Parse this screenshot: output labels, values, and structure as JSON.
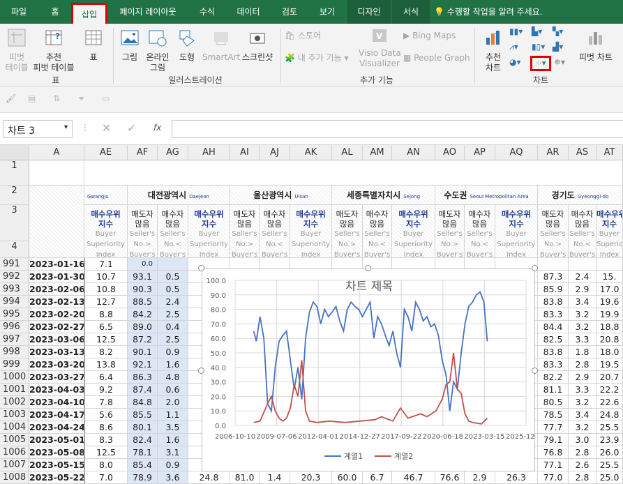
{
  "tabs": [
    "파일",
    "홈",
    "삽입",
    "페이지 레이아웃",
    "수식",
    "데이터",
    "검토",
    "보기",
    "디자인",
    "서식"
  ],
  "tell_me": "수행할 작업을 알려 주세요.",
  "ribbon": {
    "pivot": "피벗\n테이블",
    "rec_pivot": "추천\n피벗 테이블",
    "table": "표",
    "group_table": "표",
    "picture": "그림",
    "online_pic": "온라인\n그림",
    "shapes": "도형",
    "smartart": "SmartArt",
    "screenshot": "스크린샷",
    "group_illus": "일러스트레이션",
    "store": "스토어",
    "my_addins": "내 추가 기능",
    "visio": "Visio Data\nVisualizer",
    "bing": "Bing Maps",
    "people": "People Graph",
    "group_addins": "추가 기능",
    "rec_chart": "추천\n차트",
    "pivot_chart": "피벗 차트",
    "group_chart": "차트"
  },
  "namebox": "차트 3",
  "fx": "fx",
  "columns": [
    "A",
    "AE",
    "AF",
    "AG",
    "AH",
    "AI",
    "AJ",
    "AK",
    "AL",
    "AM",
    "AN",
    "AO",
    "AP",
    "AQ",
    "AR",
    "AS",
    "AT"
  ],
  "header_row2": {
    "gwangju": "Gwangju",
    "daejeon": "대전광역시",
    "daejeon_en": "Daejeon",
    "ulsan": "울산광역시",
    "ulsan_en": "Ulsan",
    "sejong": "세종특별자치시",
    "sejong_en": "Sejong",
    "capital": "수도권",
    "capital_en": "Seoul Metropolitan Area",
    "gyeonggi": "경기도",
    "gyeonggi_en": "Gyeonggi-do"
  },
  "header_row3": {
    "bsi": "매수우위\n지수",
    "sell_more": "매도자\n많음",
    "buy_more": "매수자\n많음",
    "bsi_en": "Buyer\nSuperiority\nIndex",
    "sell_en": "Seller's\nNo.>\nBuyer's",
    "buy_en": "Seller's\nNo.<\nBuyer's"
  },
  "rows": [
    {
      "n": "991",
      "date": "2023-01-16",
      "ae": "7.1",
      "af": "0.0",
      "ag": "",
      "ah": "",
      "ar": "",
      "as": "",
      "at": ""
    },
    {
      "n": "992",
      "date": "2023-01-30",
      "ae": "10.7",
      "af": "93.1",
      "ag": "0.5",
      "ah": "",
      "ar": "87.3",
      "as": "2.4",
      "at": "15."
    },
    {
      "n": "993",
      "date": "2023-02-06",
      "ae": "10.8",
      "af": "90.3",
      "ag": "0.5",
      "ah": "",
      "ar": "85.9",
      "as": "2.9",
      "at": "17.0"
    },
    {
      "n": "994",
      "date": "2023-02-13",
      "ae": "12.7",
      "af": "88.5",
      "ag": "2.4",
      "ah": "",
      "ar": "83.8",
      "as": "3.4",
      "at": "19.6"
    },
    {
      "n": "995",
      "date": "2023-02-20",
      "ae": "8.8",
      "af": "84.2",
      "ag": "2.5",
      "ah": "",
      "ar": "83.3",
      "as": "3.2",
      "at": "19.9"
    },
    {
      "n": "996",
      "date": "2023-02-27",
      "ae": "6.5",
      "af": "89.0",
      "ag": "0.4",
      "ah": "",
      "ar": "84.4",
      "as": "3.2",
      "at": "18.8"
    },
    {
      "n": "997",
      "date": "2023-03-06",
      "ae": "12.5",
      "af": "87.2",
      "ag": "2.5",
      "ah": "",
      "ar": "82.5",
      "as": "3.3",
      "at": "20.8"
    },
    {
      "n": "998",
      "date": "2023-03-13",
      "ae": "8.2",
      "af": "90.1",
      "ag": "0.9",
      "ah": "",
      "ar": "83.8",
      "as": "1.8",
      "at": "18.0"
    },
    {
      "n": "999",
      "date": "2023-03-20",
      "ae": "13.8",
      "af": "92.1",
      "ag": "1.6",
      "ah": "",
      "ar": "83.3",
      "as": "2.8",
      "at": "19.5"
    },
    {
      "n": "1000",
      "date": "2023-03-27",
      "ae": "6.4",
      "af": "86.3",
      "ag": "4.8",
      "ah": "",
      "ar": "82.2",
      "as": "2.9",
      "at": "20.7"
    },
    {
      "n": "1001",
      "date": "2023-04-03",
      "ae": "9.2",
      "af": "87.4",
      "ag": "0.6",
      "ah": "",
      "ar": "81.1",
      "as": "3.3",
      "at": "22.2"
    },
    {
      "n": "1002",
      "date": "2023-04-10",
      "ae": "7.8",
      "af": "84.8",
      "ag": "2.0",
      "ah": "",
      "ar": "80.5",
      "as": "3.2",
      "at": "22.6"
    },
    {
      "n": "1003",
      "date": "2023-04-17",
      "ae": "5.6",
      "af": "85.5",
      "ag": "1.1",
      "ah": "",
      "ar": "78.5",
      "as": "3.4",
      "at": "24.8"
    },
    {
      "n": "1004",
      "date": "2023-04-24",
      "ae": "8.6",
      "af": "80.1",
      "ag": "3.5",
      "ah": "2",
      "ar": "77.7",
      "as": "3.2",
      "at": "25.5"
    },
    {
      "n": "1005",
      "date": "2023-05-01",
      "ae": "8.3",
      "af": "82.4",
      "ag": "1.6",
      "ah": "",
      "ar": "79.1",
      "as": "3.0",
      "at": "23.9"
    },
    {
      "n": "1006",
      "date": "2023-05-08",
      "ae": "12.5",
      "af": "78.1",
      "ag": "3.1",
      "ah": "2",
      "ar": "76.8",
      "as": "2.8",
      "at": "26.0"
    },
    {
      "n": "1007",
      "date": "2023-05-15",
      "ae": "8.0",
      "af": "85.4",
      "ag": "0.9",
      "ah": "",
      "ar": "77.1",
      "as": "2.6",
      "at": "25.5"
    },
    {
      "n": "1008",
      "date": "2023-05-22",
      "ae": "7.0",
      "af": "78.9",
      "ag": "3.6",
      "ah": "24.8",
      "ar": "77.0",
      "as": "2.8",
      "at": "25.0",
      "ai": "81.0",
      "aj": "1.4",
      "ak": "20.3",
      "al": "60.0",
      "am": "6.7",
      "an": "46.7",
      "ao": "76.6",
      "ap": "2.9",
      "aq": "26.3"
    }
  ],
  "chart_data": {
    "type": "line",
    "title": "차트 제목",
    "ylim": [
      0,
      100
    ],
    "yticks": [
      "100.0",
      "90.0",
      "80.0",
      "70.0",
      "60.0",
      "50.0",
      "40.0",
      "30.0",
      "20.0",
      "10.0",
      "0.0"
    ],
    "xticks": [
      "2006-10-10",
      "2009-07-06",
      "2012-04-01",
      "2014-12-27",
      "2017-09-22",
      "2020-06-18",
      "2023-03-15",
      "2025-12-09"
    ],
    "x_range": [
      "2006-10-10",
      "2025-12-09"
    ],
    "grid": true,
    "legend_position": "bottom",
    "series": [
      {
        "name": "계열1",
        "color": "#4472c4",
        "points": [
          [
            "2008-01-01",
            65
          ],
          [
            "2008-03-01",
            58
          ],
          [
            "2008-06-01",
            75
          ],
          [
            "2008-09-01",
            60
          ],
          [
            "2008-12-01",
            15
          ],
          [
            "2009-03-01",
            10
          ],
          [
            "2009-06-01",
            40
          ],
          [
            "2009-09-01",
            58
          ],
          [
            "2009-12-01",
            62
          ],
          [
            "2010-03-01",
            65
          ],
          [
            "2010-06-01",
            45
          ],
          [
            "2010-09-01",
            25
          ],
          [
            "2010-12-01",
            40
          ],
          [
            "2011-03-01",
            18
          ],
          [
            "2011-06-01",
            60
          ],
          [
            "2011-09-01",
            78
          ],
          [
            "2011-12-01",
            85
          ],
          [
            "2012-03-01",
            82
          ],
          [
            "2012-06-01",
            70
          ],
          [
            "2012-09-01",
            80
          ],
          [
            "2012-12-01",
            75
          ],
          [
            "2013-03-01",
            78
          ],
          [
            "2013-06-01",
            82
          ],
          [
            "2013-09-01",
            72
          ],
          [
            "2013-12-01",
            65
          ],
          [
            "2014-03-01",
            80
          ],
          [
            "2014-06-01",
            85
          ],
          [
            "2014-09-01",
            82
          ],
          [
            "2014-12-01",
            80
          ],
          [
            "2015-03-01",
            75
          ],
          [
            "2015-06-01",
            80
          ],
          [
            "2015-09-01",
            85
          ],
          [
            "2015-12-01",
            60
          ],
          [
            "2016-03-01",
            75
          ],
          [
            "2016-06-01",
            70
          ],
          [
            "2016-09-01",
            62
          ],
          [
            "2016-12-01",
            55
          ],
          [
            "2017-03-01",
            65
          ],
          [
            "2017-06-01",
            50
          ],
          [
            "2017-09-01",
            40
          ],
          [
            "2017-12-01",
            80
          ],
          [
            "2018-03-01",
            75
          ],
          [
            "2018-06-01",
            65
          ],
          [
            "2018-09-01",
            85
          ],
          [
            "2018-12-01",
            80
          ],
          [
            "2019-03-01",
            72
          ],
          [
            "2019-06-01",
            75
          ],
          [
            "2019-09-01",
            68
          ],
          [
            "2019-12-01",
            70
          ],
          [
            "2020-03-01",
            62
          ],
          [
            "2020-06-01",
            45
          ],
          [
            "2020-09-01",
            35
          ],
          [
            "2020-12-01",
            10
          ],
          [
            "2021-03-01",
            30
          ],
          [
            "2021-06-01",
            25
          ],
          [
            "2021-09-01",
            50
          ],
          [
            "2021-12-01",
            70
          ],
          [
            "2022-03-01",
            82
          ],
          [
            "2022-06-01",
            85
          ],
          [
            "2022-09-01",
            90
          ],
          [
            "2022-12-01",
            92
          ],
          [
            "2023-03-01",
            85
          ],
          [
            "2023-05-22",
            58
          ]
        ]
      },
      {
        "name": "계열2",
        "color": "#c0504d",
        "points": [
          [
            "2008-01-01",
            2
          ],
          [
            "2008-06-01",
            3
          ],
          [
            "2008-12-01",
            15
          ],
          [
            "2009-03-01",
            20
          ],
          [
            "2009-06-01",
            10
          ],
          [
            "2009-09-01",
            5
          ],
          [
            "2009-12-01",
            3
          ],
          [
            "2010-03-01",
            5
          ],
          [
            "2010-06-01",
            12
          ],
          [
            "2010-09-01",
            28
          ],
          [
            "2010-12-01",
            20
          ],
          [
            "2011-03-01",
            45
          ],
          [
            "2011-06-01",
            10
          ],
          [
            "2011-09-01",
            3
          ],
          [
            "2012-03-01",
            2
          ],
          [
            "2013-01-01",
            3
          ],
          [
            "2014-01-01",
            2
          ],
          [
            "2015-01-01",
            3
          ],
          [
            "2016-01-01",
            4
          ],
          [
            "2016-06-01",
            6
          ],
          [
            "2017-03-01",
            3
          ],
          [
            "2017-09-01",
            12
          ],
          [
            "2018-03-01",
            5
          ],
          [
            "2019-01-01",
            8
          ],
          [
            "2019-06-01",
            6
          ],
          [
            "2020-01-01",
            10
          ],
          [
            "2020-06-01",
            18
          ],
          [
            "2020-09-01",
            28
          ],
          [
            "2020-12-01",
            30
          ],
          [
            "2021-03-01",
            50
          ],
          [
            "2021-06-01",
            25
          ],
          [
            "2021-09-01",
            22
          ],
          [
            "2021-12-01",
            8
          ],
          [
            "2022-03-01",
            3
          ],
          [
            "2022-06-01",
            2
          ],
          [
            "2023-01-01",
            1
          ],
          [
            "2023-05-22",
            5
          ]
        ]
      }
    ]
  }
}
